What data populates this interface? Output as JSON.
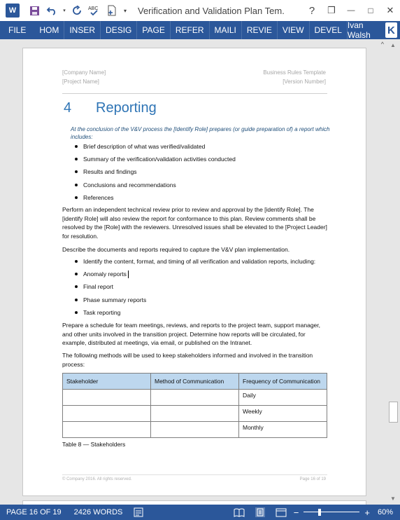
{
  "titlebar": {
    "app_logo": "W",
    "title": "Verification and Validation Plan Tem...",
    "help": "?",
    "minimize": "—",
    "restore": "❐",
    "close": "✕"
  },
  "ribbon": {
    "tabs": [
      "FILE",
      "HOM",
      "INSER",
      "DESIG",
      "PAGE",
      "REFER",
      "MAILI",
      "REVIE",
      "VIEW",
      "DEVEL"
    ],
    "user": "Ivan Walsh",
    "user_initial": "K",
    "collapse": "^"
  },
  "document": {
    "header": {
      "company": "[Company Name]",
      "project": "[Project Name]",
      "template": "Business Rules Template",
      "version": "[Version Number]"
    },
    "heading": {
      "number": "4",
      "title": "Reporting"
    },
    "instruction": "At the conclusion of the V&V process the [Identify Role] prepares (or guide preparation of) a report which includes:",
    "bullets1": [
      "Brief description of what was verified/validated",
      "Summary of the verification/validation activities conducted",
      "Results and findings",
      "Conclusions and recommendations",
      "References"
    ],
    "para1": "Perform an independent technical review prior to review and approval by the [identify Role]. The [identify Role] will also review the report for conformance to this plan. Review comments shall be resolved by the [Role] with the reviewers. Unresolved issues shall be elevated to the [Project Leader] for resolution.",
    "para2": "Describe the documents and reports required to capture the V&V plan implementation.",
    "bullets2": [
      "Identify the content, format, and timing of all verification and validation reports, including:",
      "Anomaly reports",
      "Final report",
      "Phase summary reports",
      "Task reporting"
    ],
    "para3": "Prepare a schedule for team meetings, reviews, and reports to the project team, support manager, and other units involved in the transition project. Determine how reports will be circulated, for example, distributed at meetings, via email, or published on the Intranet.",
    "para4": "The following methods will be used to keep stakeholders informed and involved in the transition process:",
    "table": {
      "headers": [
        "Stakeholder",
        "Method of Communication",
        "Frequency of Communication"
      ],
      "rows": [
        [
          "",
          "",
          "Daily"
        ],
        [
          "",
          "",
          "Weekly"
        ],
        [
          "",
          "",
          "Monthly"
        ]
      ]
    },
    "caption": "Table 8 — Stakeholders",
    "footer": {
      "copyright": "© Company 2016. All rights reserved.",
      "page": "Page 16 of 19"
    }
  },
  "statusbar": {
    "page": "PAGE 16 OF 19",
    "words": "2426 WORDS",
    "zoom_minus": "−",
    "zoom_plus": "+",
    "zoom": "60%",
    "zoom_level_percent": 60
  },
  "colors": {
    "accent": "#2b579a",
    "heading": "#2e74b5",
    "table_header": "#bdd7ee"
  }
}
